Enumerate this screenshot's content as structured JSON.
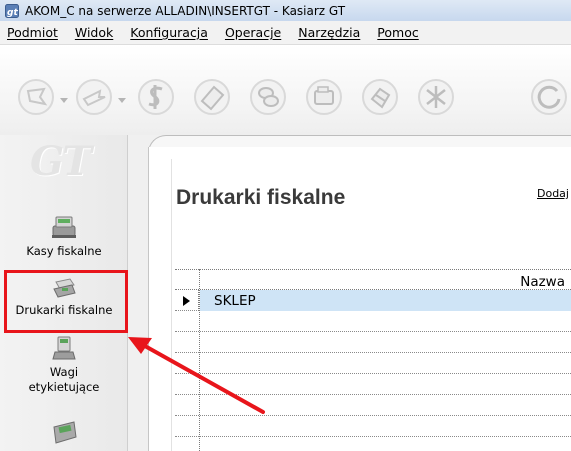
{
  "window": {
    "title": "AKOM_C na serwerze ALLADIN\\INSERTGT - Kasiarz GT",
    "logo_text": "GT"
  },
  "menu": {
    "items": [
      "Podmiot",
      "Widok",
      "Konfiguracja",
      "Operacje",
      "Narzędzia",
      "Pomoc"
    ]
  },
  "toolbar": {
    "icons": [
      "back-arrow-icon",
      "forward-arrow-icon",
      "dollar-icon",
      "eraser-icon",
      "coins-icon",
      "register-icon",
      "hand-icon",
      "scales-icon",
      "refresh-icon"
    ]
  },
  "sidebar": {
    "items": [
      {
        "label": "Kasy fiskalne",
        "icon": "cash-register-icon"
      },
      {
        "label": "Drukarki fiskalne",
        "icon": "fiscal-printer-icon"
      },
      {
        "label": "Wagi etykietujące",
        "icon": "label-scale-icon"
      },
      {
        "label": "",
        "icon": "terminal-icon"
      }
    ]
  },
  "main": {
    "page_title": "Drukarki fiskalne",
    "add_link": "Dodaj",
    "table": {
      "columns": [
        "Nazwa"
      ],
      "rows": [
        {
          "name": "SKLEP",
          "selected": true
        }
      ]
    }
  },
  "colors": {
    "highlight": "#e8151b",
    "selected_row": "#cfe4f6",
    "title_bar": "#dfe9f5"
  }
}
